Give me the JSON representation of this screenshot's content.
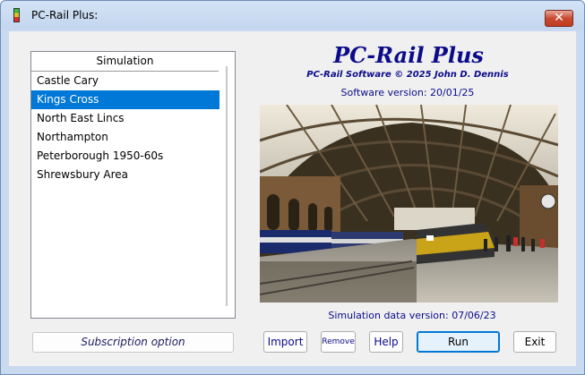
{
  "window": {
    "title": "PC-Rail Plus:",
    "close_glyph": "✕"
  },
  "simulation_list": {
    "header": "Simulation",
    "items": [
      {
        "label": "Castle Cary",
        "selected": false
      },
      {
        "label": "Kings Cross",
        "selected": true
      },
      {
        "label": "North East Lincs",
        "selected": false
      },
      {
        "label": "Northampton",
        "selected": false
      },
      {
        "label": "Peterborough 1950-60s",
        "selected": false
      },
      {
        "label": "Shrewsbury Area",
        "selected": false
      }
    ]
  },
  "subscription_button": "Subscription option",
  "branding": {
    "title": "PC-Rail Plus",
    "copyright": "PC-Rail Software © 2025 John D. Dennis",
    "software_version": "Software version: 20/01/25"
  },
  "simulation_data_version": "Simulation data version: 07/06/23",
  "buttons": {
    "import": "Import",
    "remove": "Remove",
    "help": "Help",
    "run": "Run",
    "exit": "Exit"
  },
  "colors": {
    "accent_text": "#0c0c8a",
    "selection": "#0078d7",
    "titlebar": "#c9daf0",
    "close_button": "#c84a30"
  }
}
